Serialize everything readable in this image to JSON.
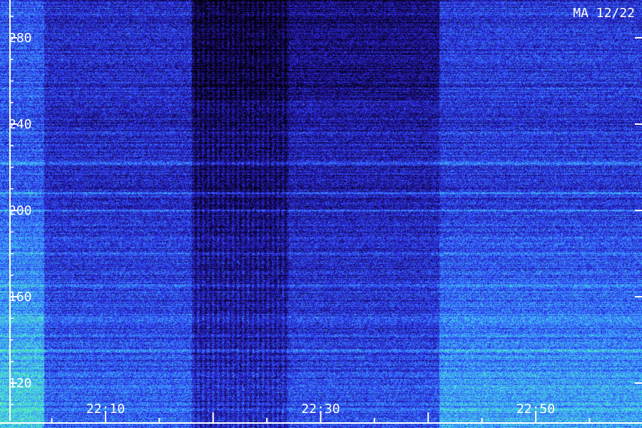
{
  "chart_data": {
    "type": "heatmap",
    "title": "MA 12/22",
    "xlabel": "",
    "ylabel": "",
    "y_ticks": [
      {
        "value": 280,
        "label": "280"
      },
      {
        "value": 240,
        "label": "240"
      },
      {
        "value": 200,
        "label": "200"
      },
      {
        "value": 160,
        "label": "160"
      },
      {
        "value": 120,
        "label": "120"
      }
    ],
    "x_ticks": [
      {
        "minute": 10,
        "label": "22:10"
      },
      {
        "minute": 30,
        "label": "22:30"
      },
      {
        "minute": 50,
        "label": "22:50"
      }
    ],
    "x_range_minutes": [
      1,
      60
    ],
    "y_range": [
      105,
      297
    ],
    "minor_tick_step_minutes": 5,
    "colormap": [
      "#000000",
      "#1a0a6e",
      "#2a2ae8",
      "#3a7cff",
      "#40d0f0",
      "#60ffa0"
    ],
    "dark_band_minutes": [
      18,
      27
    ],
    "bright_band_minutes": [
      41,
      60
    ],
    "bright_rows": [
      236,
      222,
      208,
      200,
      180,
      165,
      150,
      135
    ]
  }
}
